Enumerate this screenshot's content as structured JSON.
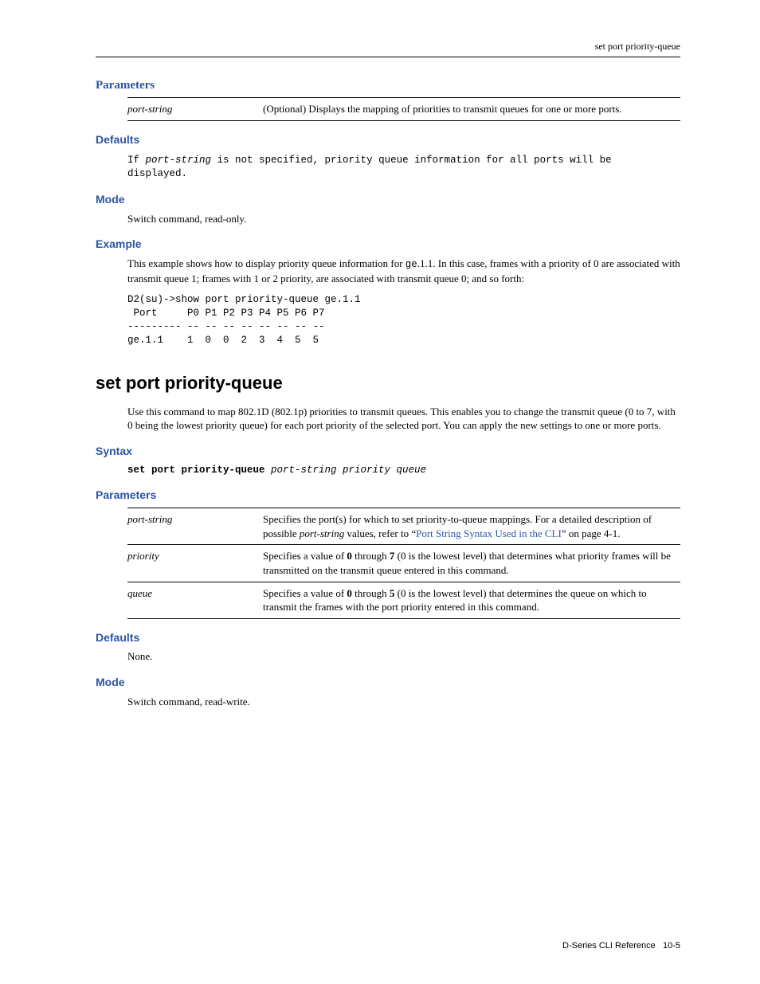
{
  "running_head": "set port priority-queue",
  "section1": {
    "parameters_h": "Parameters",
    "params": [
      {
        "name": "port-string",
        "desc": "(Optional) Displays the mapping of priorities to transmit queues for one or more ports."
      }
    ],
    "defaults_h": "Defaults",
    "defaults_pre_1": "If ",
    "defaults_pre_ital": "port-string",
    "defaults_pre_2": " is not specified, priority queue information for all ports will be \ndisplayed.",
    "mode_h": "Mode",
    "mode_text": "Switch command, read-only.",
    "example_h": "Example",
    "example_intro_1": "This example shows how to display priority queue information for ",
    "example_intro_code": "ge",
    "example_intro_2": ".1.1. In this case, frames with a priority of 0 are associated with transmit queue 1; frames with 1 or 2 priority, are associated with transmit queue 0; and so forth:",
    "chart_data": {
      "type": "table",
      "prompt": "D2(su)->show port priority-queue ge.1.1",
      "header": " Port     P0 P1 P2 P3 P4 P5 P6 P7",
      "divider": "--------- -- -- -- -- -- -- -- --",
      "row": "ge.1.1    1  0  0  2  3  4  5  5 "
    }
  },
  "section2": {
    "title": "set port priority-queue",
    "intro": "Use this command to map 802.1D (802.1p) priorities to transmit queues. This enables you to change the transmit queue (0 to 7, with 0 being the lowest priority queue) for each port priority of the selected port. You can apply the new settings to one or more ports.",
    "syntax_h": "Syntax",
    "syntax_bold": "set port priority-queue",
    "syntax_ital": " port-string priority queue",
    "parameters_h": "Parameters",
    "params": [
      {
        "name": "port-string",
        "d0": "Specifies the port(s) for which to set priority-to-queue mappings. For a detailed description of possible ",
        "d1_i": "port-string",
        "d2": " values, refer to “",
        "d3_link": "Port String Syntax Used in the CLI",
        "d4": "” on page 4-1."
      },
      {
        "name": "priority",
        "d0": "Specifies a value of ",
        "d1_b": "0",
        "d2": " through ",
        "d3_b": "7",
        "d4": " (0 is the lowest level) that determines what priority frames will be transmitted on the transmit queue entered in this command."
      },
      {
        "name": "queue",
        "d0": "Specifies a value of ",
        "d1_b": "0",
        "d2": " through ",
        "d3_b": "5",
        "d4": " (0 is the lowest level) that determines the queue on which to transmit the frames with the port priority entered in this command."
      }
    ],
    "defaults_h": "Defaults",
    "defaults_text": "None.",
    "mode_h": "Mode",
    "mode_text": "Switch command, read-write."
  },
  "footer": {
    "doc": "D-Series CLI Reference",
    "page": "10-5"
  }
}
